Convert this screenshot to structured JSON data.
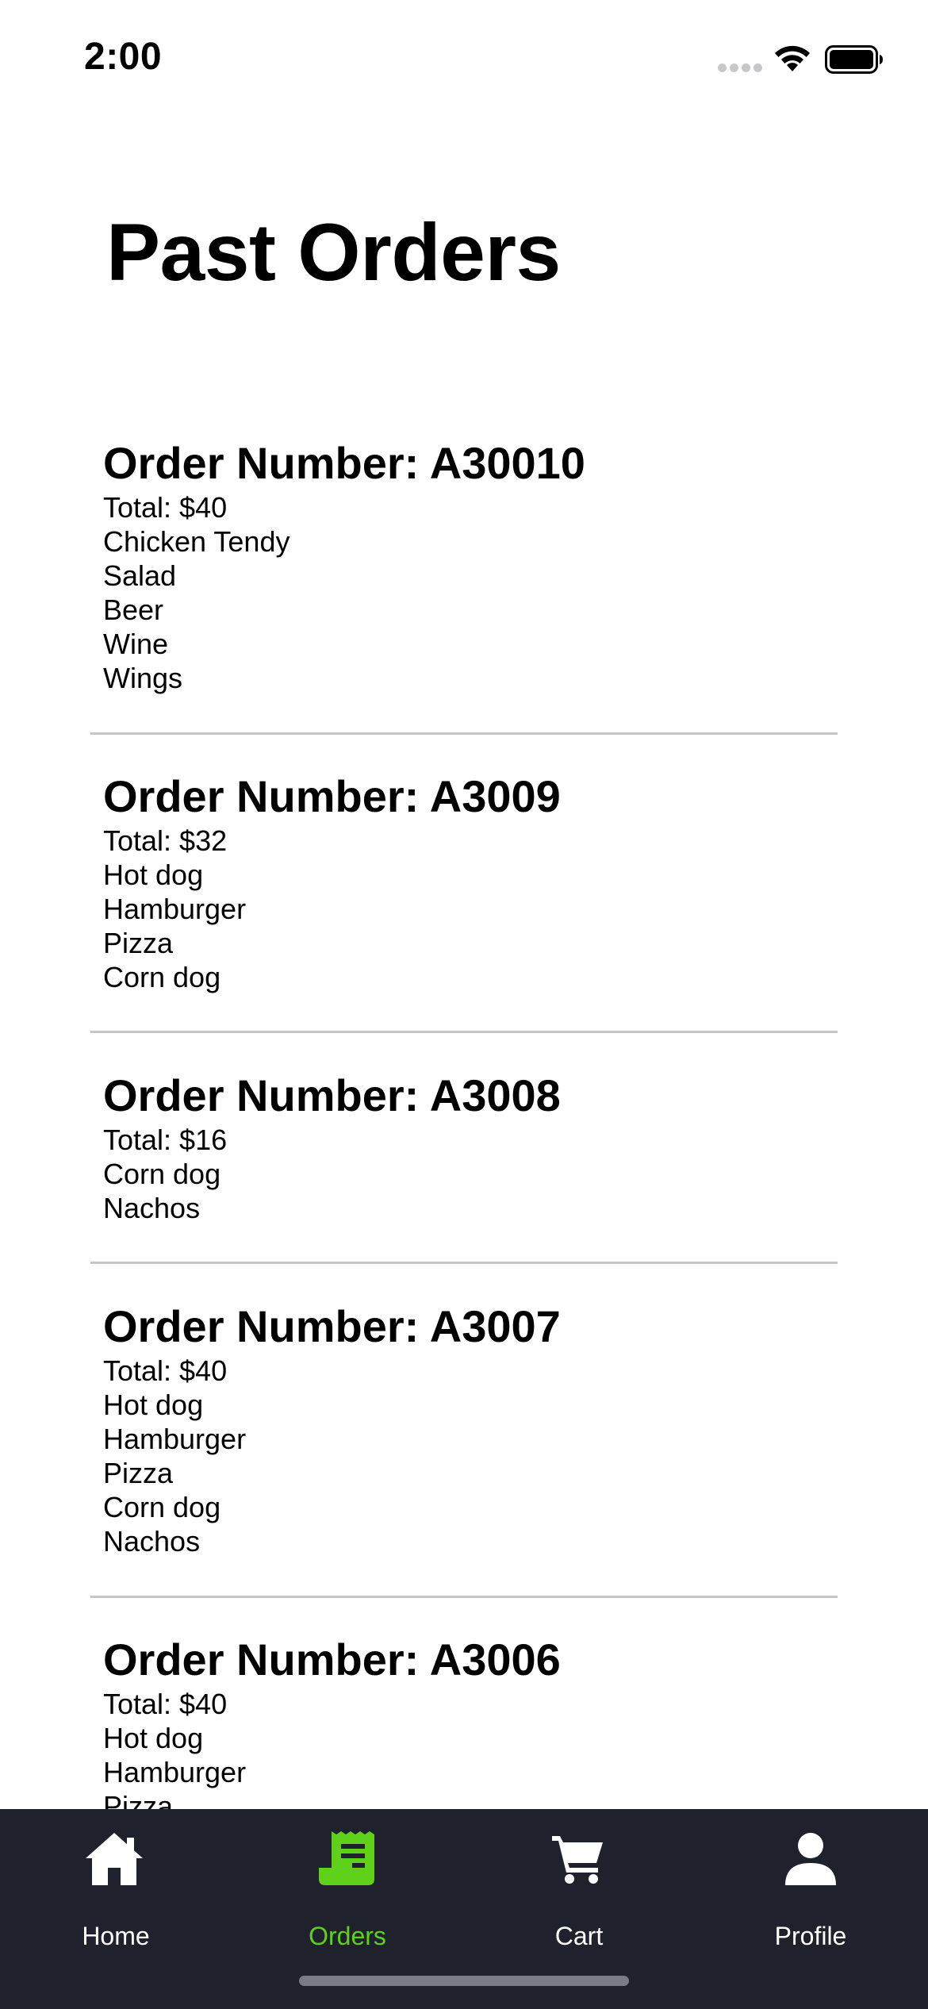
{
  "status_bar": {
    "time": "2:00"
  },
  "page": {
    "title": "Past Orders"
  },
  "orders": [
    {
      "heading": "Order Number: A30010",
      "total": "Total: $40",
      "items": [
        "Chicken Tendy",
        "Salad",
        "Beer",
        "Wine",
        "Wings"
      ]
    },
    {
      "heading": "Order Number: A3009",
      "total": "Total: $32",
      "items": [
        "Hot dog",
        "Hamburger",
        "Pizza",
        "Corn dog"
      ]
    },
    {
      "heading": "Order Number: A3008",
      "total": "Total: $16",
      "items": [
        "Corn dog",
        "Nachos"
      ]
    },
    {
      "heading": "Order Number: A3007",
      "total": "Total: $40",
      "items": [
        "Hot dog",
        "Hamburger",
        "Pizza",
        "Corn dog",
        "Nachos"
      ]
    },
    {
      "heading": "Order Number: A3006",
      "total": "Total: $40",
      "items": [
        "Hot dog",
        "Hamburger",
        "Pizza"
      ]
    }
  ],
  "tab_bar": {
    "tabs": [
      {
        "label": "Home",
        "icon": "home-icon",
        "active": false
      },
      {
        "label": "Orders",
        "icon": "receipt-icon",
        "active": true
      },
      {
        "label": "Cart",
        "icon": "cart-icon",
        "active": false
      },
      {
        "label": "Profile",
        "icon": "person-icon",
        "active": false
      }
    ],
    "background": "#1f222d",
    "active_color": "#5fd11b",
    "inactive_color": "#ffffff"
  }
}
